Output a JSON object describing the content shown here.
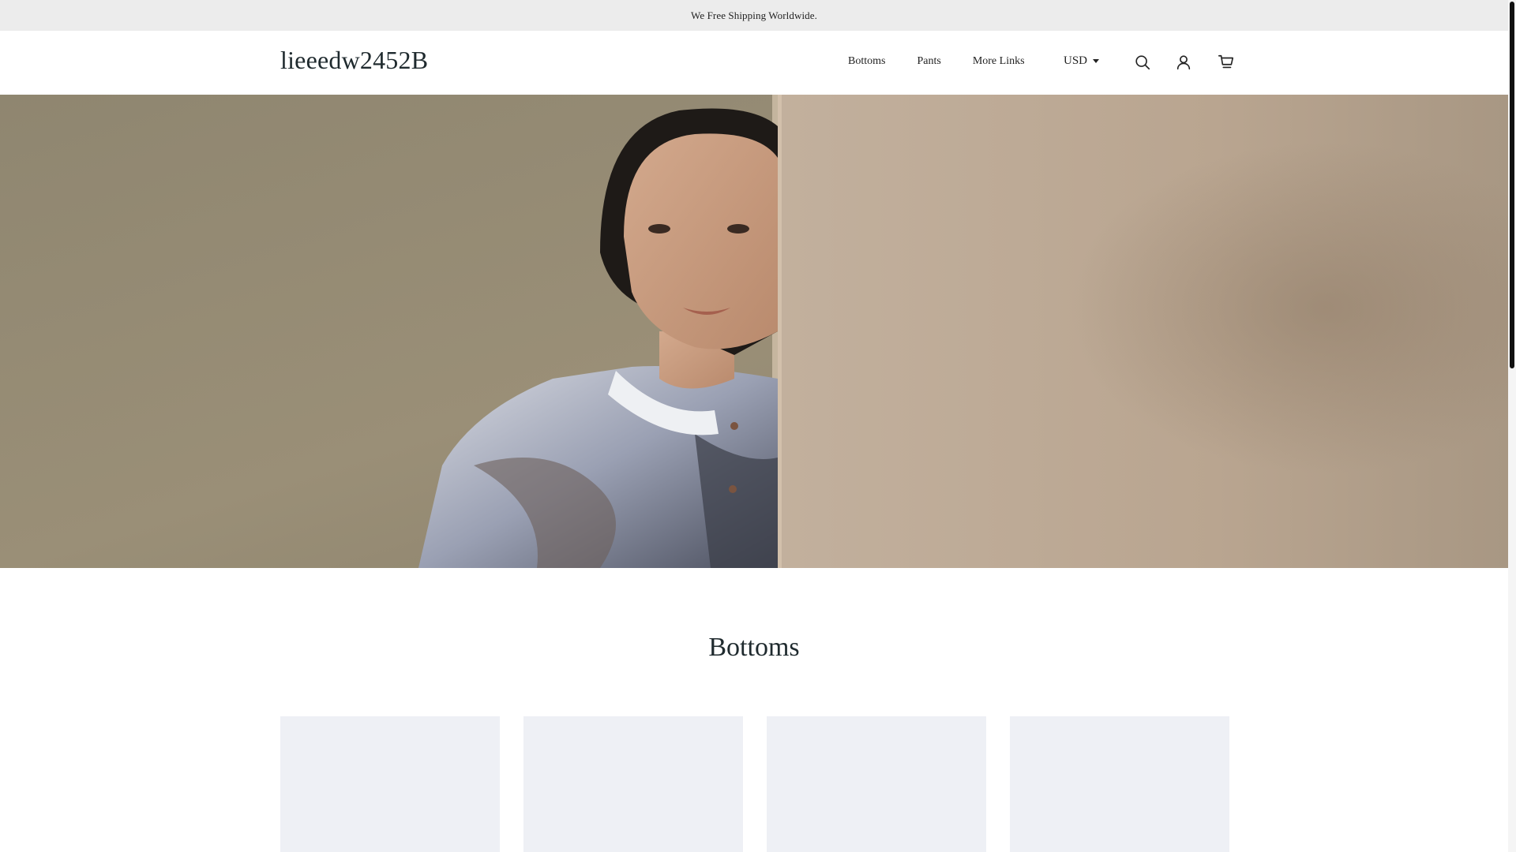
{
  "announcement": {
    "text": "We Free Shipping Worldwide."
  },
  "header": {
    "logo": "lieeedw2452B",
    "nav": [
      {
        "label": "Bottoms"
      },
      {
        "label": "Pants"
      },
      {
        "label": "More Links"
      }
    ],
    "currency": "USD",
    "icons": [
      "search-icon",
      "account-icon",
      "cart-icon"
    ]
  },
  "hero": {
    "image": "banner-woman-patterned-shirt-beside-wall"
  },
  "collection": {
    "title": "Bottoms",
    "products": [
      {},
      {},
      {},
      {}
    ]
  }
}
